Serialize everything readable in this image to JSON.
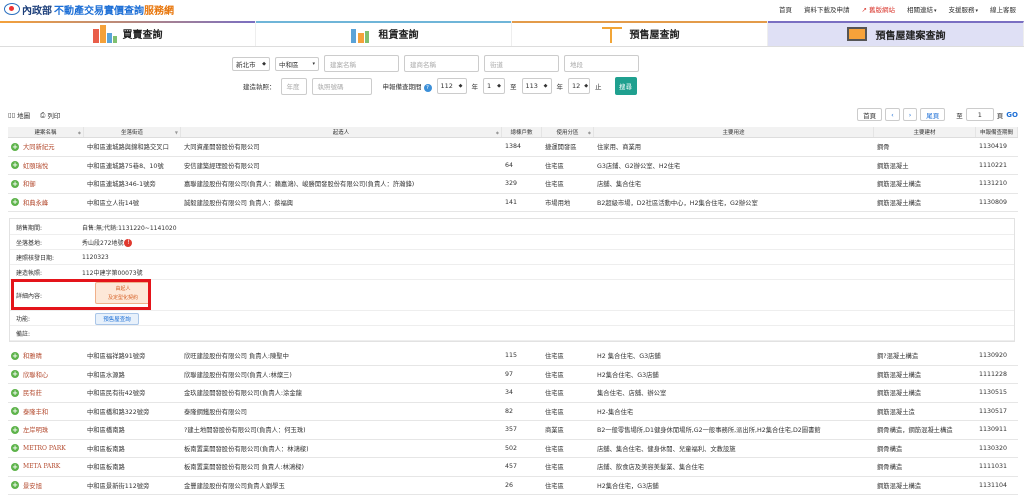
{
  "header": {
    "logo_text": "內政部",
    "site_title": "不動產交易實價查詢",
    "site_title_suffix": "服務網",
    "nav": [
      {
        "label": "首頁"
      },
      {
        "label": "資料下載及申請"
      },
      {
        "label": "舊版網站"
      },
      {
        "label": "相關連結"
      },
      {
        "label": "支援服務"
      },
      {
        "label": "線上客服"
      }
    ]
  },
  "tabs": [
    {
      "label": "買賣查詢"
    },
    {
      "label": "租賃查詢"
    },
    {
      "label": "預售屋查詢"
    },
    {
      "label": "預售屋建案查詢"
    }
  ],
  "search": {
    "city": "新北市",
    "district": "中和區",
    "project_name_placeholder": "建案名稱",
    "builder_placeholder": "建商名稱",
    "street_placeholder": "街道",
    "lot_placeholder": "地段",
    "permit_label": "建造執照：",
    "permit_year_placeholder": "年度",
    "permit_no_placeholder": "執照號碼",
    "period_label": "申報備查期間",
    "from_year": "112",
    "from_month": "1",
    "to_year": "113",
    "to_month": "12",
    "year_unit": "年",
    "month_unit": "月",
    "to_label": "至",
    "end_label": "止",
    "search_button": "搜尋"
  },
  "toolbar": {
    "map_label": "地圖",
    "print_label": "列印",
    "first_page": "首頁",
    "prev": "‹",
    "next": "›",
    "last_page": "尾頁",
    "goto_label": "至",
    "page_value": "1",
    "page_unit": "頁",
    "go": "GO"
  },
  "table": {
    "columns": [
      "建案名稱",
      "坐落街道",
      "起造人",
      "總棟戶數",
      "使用分區",
      "主要用途",
      "主要建材",
      "申報備查期間"
    ],
    "rows_top": [
      {
        "name": "大同新紀元",
        "street": "中和區連城路與錦和路交叉口",
        "builder": "大同資產開發股份有限公司",
        "units": "1384",
        "zone": "捷運開發區",
        "use": "住家用、商業用",
        "material": "鋼骨",
        "period": "1130419"
      },
      {
        "name": "虹頤瑞悅",
        "street": "中和區連城路75巷8、10號",
        "builder": "安信建築經理股份有限公司",
        "units": "64",
        "zone": "住宅區",
        "use": "G3店鋪、G2辦公室、H2住宅",
        "material": "鋼筋混凝土",
        "period": "1110221"
      },
      {
        "name": "和御",
        "street": "中和區連城路346-1號旁",
        "builder": "嘉聯建設股份有限公司(負責人：賴嘉鴻)、峻勝開發股份有限公司(負責人：許瀚鋒)",
        "units": "329",
        "zone": "住宅區",
        "use": "店舖、集合住宅",
        "material": "鋼筋混凝土構造",
        "period": "1131210"
      },
      {
        "name": "和典永峰",
        "street": "中和區立人街14號",
        "builder": "誠毅建設股份有限公司 負責人：蔡福興",
        "units": "141",
        "zone": "市場用地",
        "use": "B2超級市場，D2社區活動中心，H2集合住宅，G2辦公室",
        "material": "鋼筋混凝土構造",
        "period": "1130809"
      }
    ],
    "rows_bottom": [
      {
        "name": "和雅晴",
        "street": "中和區福祥路91號旁",
        "builder": "欣旺建設股份有限公司 負責人:陳聖中",
        "units": "115",
        "zone": "住宅區",
        "use": "H2 集合住宅、G3店舖",
        "material": "鋼?混凝土構造",
        "period": "1130920"
      },
      {
        "name": "欣聯和心",
        "street": "中和區水源路",
        "builder": "欣聯建設股份有限公司(負責人:林燦三)",
        "units": "97",
        "zone": "住宅區",
        "use": "H2集合住宅、G3店舖",
        "material": "鋼筋混凝土構造",
        "period": "1111228"
      },
      {
        "name": "民有莊",
        "street": "中和區民有街42號旁",
        "builder": "金玖建設開發股份有限公司(負責人:涂金龍",
        "units": "34",
        "zone": "住宅區",
        "use": "集合住宅、店舖、辦公室",
        "material": "鋼筋混凝土構造",
        "period": "1130515"
      },
      {
        "name": "泰隆丰和",
        "street": "中和區橋和路322號旁",
        "builder": "泰隆鋼鐵股份有限公司",
        "units": "82",
        "zone": "住宅區",
        "use": "H2-集合住宅",
        "material": "鋼筋混凝土造",
        "period": "1130517"
      },
      {
        "name": "左岸明珠",
        "street": "中和區橋南路",
        "builder": "?建土地開發股份有限公司(負責人：何玉珠)",
        "units": "357",
        "zone": "商業區",
        "use": "B2一般零售場所,D1健身休閒場所,G2一般事務所,派出所,H2集合住宅,D2圖書館",
        "material": "鋼骨構造，鋼筋混凝土構造",
        "period": "1130911"
      },
      {
        "name": "METRO PARK",
        "street": "中和區板南路",
        "builder": "板南置業開發股份有限公司(負責人：林鴻樑)",
        "units": "502",
        "zone": "住宅區",
        "use": "店舖、集合住宅、健身休閒、兒童福利、文教設施",
        "material": "鋼骨構造",
        "period": "1130320"
      },
      {
        "name": "META PARK",
        "street": "中和區板南路",
        "builder": "板南置業開發股份有限公司 負責人:林鴻樑)",
        "units": "457",
        "zone": "住宅區",
        "use": "店鋪、飲食店及美容美髮業、集合住宅",
        "material": "鋼骨構造",
        "period": "1111031"
      },
      {
        "name": "景安旭",
        "street": "中和區景新街112號旁",
        "builder": "金豐建設股份有限公司負責人劉學玉",
        "units": "26",
        "zone": "住宅區",
        "use": "H2集合住宅，G3店舖",
        "material": "鋼筋混凝土構造",
        "period": "1131104"
      }
    ]
  },
  "detail": {
    "fields": [
      {
        "label": "銷售期間:",
        "value": "自售:無;代銷:1131220~1141020"
      },
      {
        "label": "坐落基地:",
        "value": "秀山段272地號"
      },
      {
        "label": "建照核發日期:",
        "value": "1120323"
      },
      {
        "label": "建造執照:",
        "value": "112中建字第00073號"
      },
      {
        "label": "詳細內容:",
        "value": ""
      },
      {
        "label": "功能:",
        "value": ""
      },
      {
        "label": "備註:",
        "value": ""
      }
    ],
    "contract_button_line1": "由起人",
    "contract_button_line2": "及定型化契約",
    "function_button": "預售屋查詢"
  },
  "colors": {
    "accent": "#1d6fd6",
    "brand_orange": "#e8780f",
    "project_name": "#b3492d",
    "highlight_box": "#e4141a",
    "search_button": "#1fa08f"
  }
}
